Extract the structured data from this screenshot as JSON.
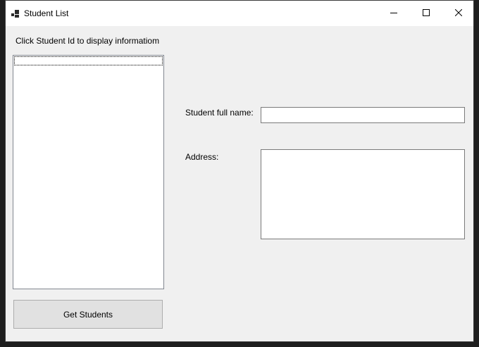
{
  "window": {
    "title": "Student List",
    "icon": "winforms-app-icon",
    "controls": {
      "minimize_icon": "minimize-icon",
      "maximize_icon": "maximize-icon",
      "close_icon": "close-icon"
    }
  },
  "main": {
    "hint": "Click Student Id to display informatiom",
    "student_list": {
      "items": []
    },
    "get_students_button": "Get Students",
    "full_name": {
      "label": "Student full name:",
      "value": ""
    },
    "address": {
      "label": "Address:",
      "value": ""
    }
  },
  "colors": {
    "form_background": "#f0f0f0",
    "titlebar": "#ffffff",
    "button_face": "#e1e1e1",
    "control_border": "#7a7a7a"
  }
}
